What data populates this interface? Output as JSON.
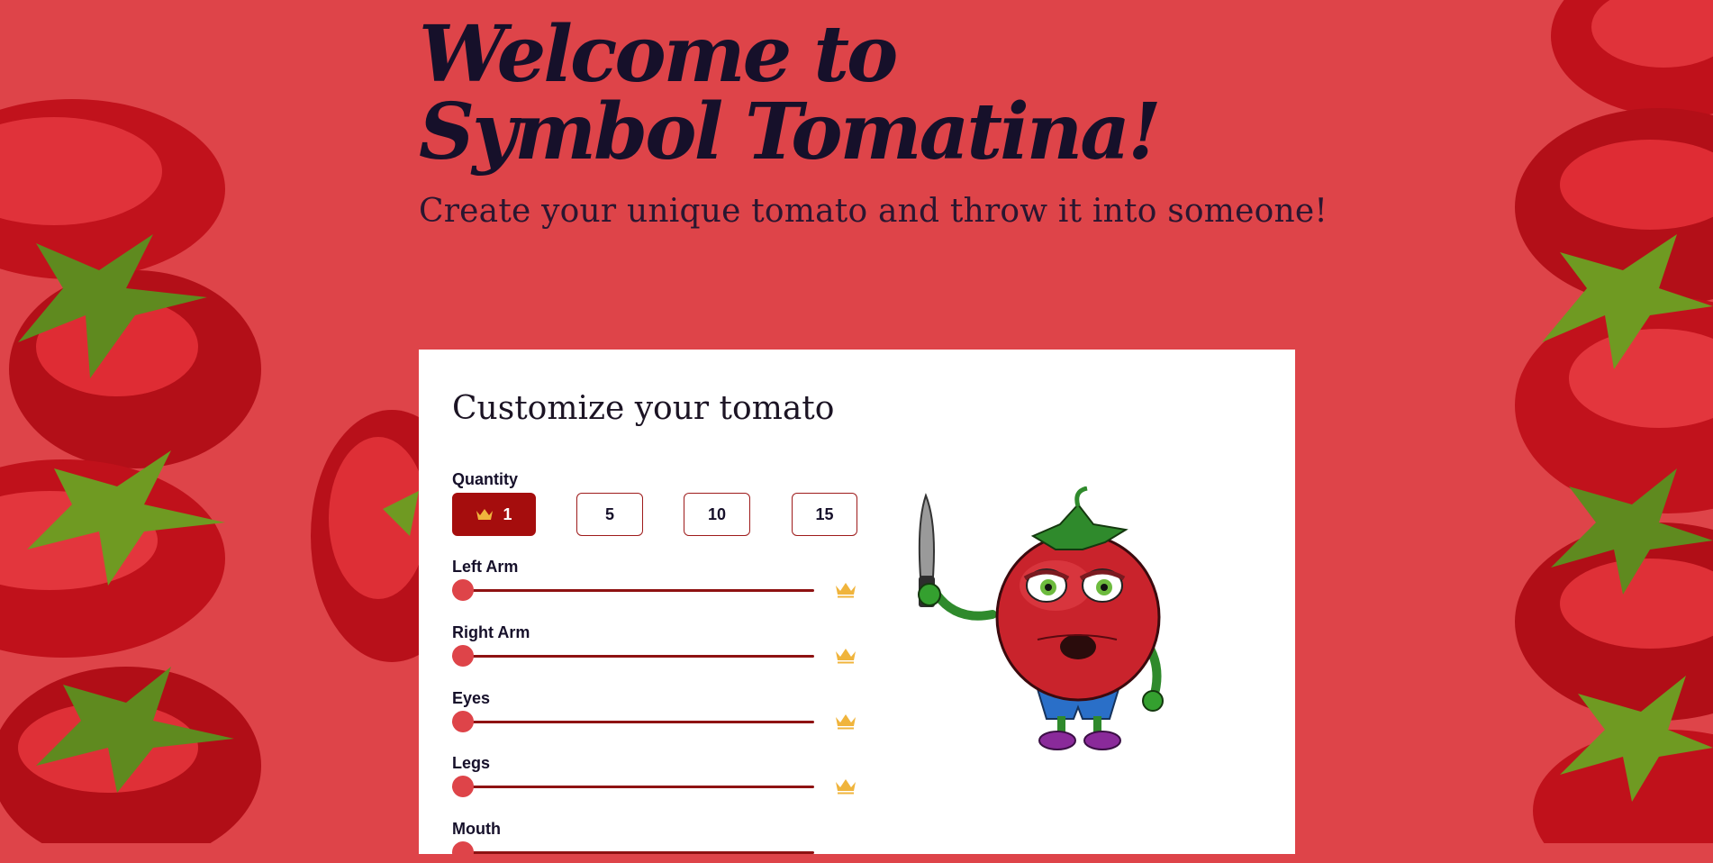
{
  "hero": {
    "title_line1": "Welcome to",
    "title_line2": "Symbol Tomatina!",
    "subtitle": "Create your unique tomato and throw it into someone!"
  },
  "card": {
    "title": "Customize your tomato",
    "quantity": {
      "label": "Quantity",
      "options": [
        "1",
        "5",
        "10",
        "15"
      ],
      "selected": "1"
    },
    "sliders": {
      "left_arm": {
        "label": "Left Arm",
        "value": 0
      },
      "right_arm": {
        "label": "Right Arm",
        "value": 0
      },
      "eyes": {
        "label": "Eyes",
        "value": 0
      },
      "legs": {
        "label": "Legs",
        "value": 0
      },
      "mouth": {
        "label": "Mouth",
        "value": 0
      }
    }
  },
  "colors": {
    "background": "#de4449",
    "accent": "#a50d0d",
    "crown": "#f0b43c",
    "text": "#16102a"
  },
  "icons": [
    "crown-icon",
    "tomato-mascot-illustration",
    "tomato-vine-decoration"
  ]
}
